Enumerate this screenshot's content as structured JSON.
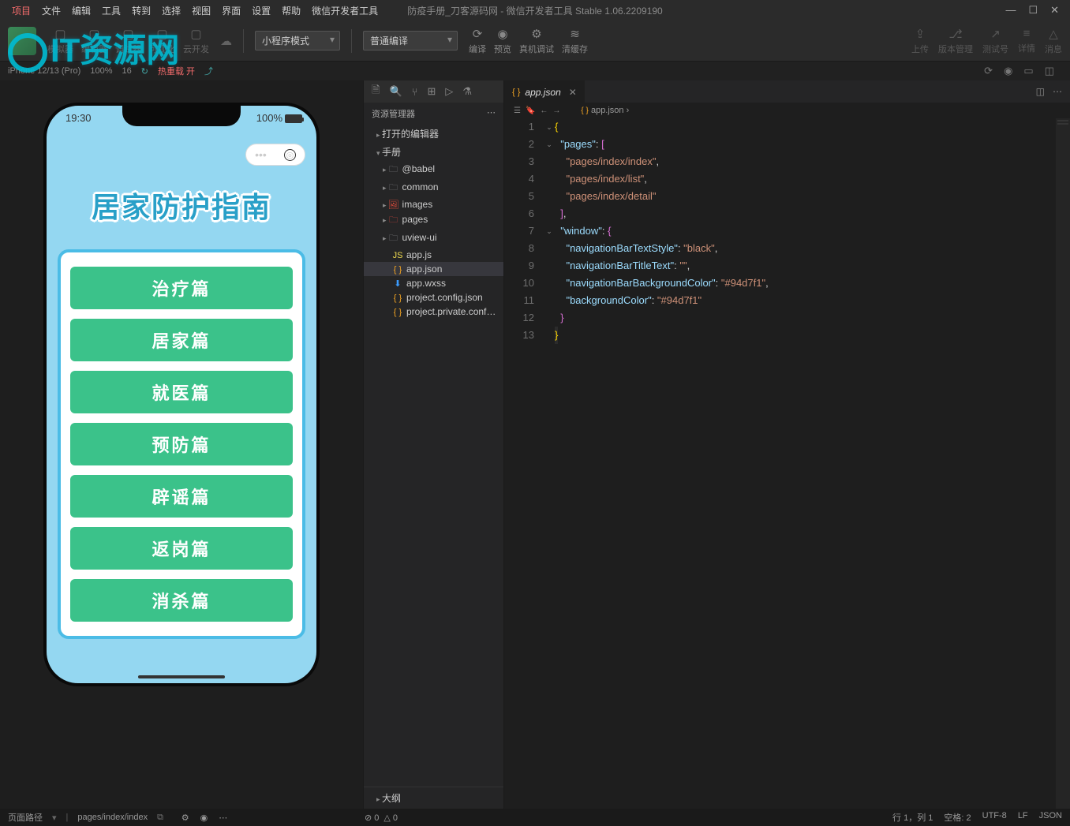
{
  "watermark": "IT资源网",
  "titlebar": {
    "menus": [
      "项目",
      "文件",
      "编辑",
      "工具",
      "转到",
      "选择",
      "视图",
      "界面",
      "设置",
      "帮助",
      "微信开发者工具"
    ],
    "title": "防疫手册_刀客源码网 - 微信开发者工具 Stable 1.06.2209190"
  },
  "toolbar": {
    "groups1": [
      "模拟器",
      "编辑器",
      "调试器",
      "可视化",
      "云开发"
    ],
    "select1": "小程序模式",
    "select2": "普通编译",
    "actions": [
      {
        "icon": "⟳",
        "label": "编译"
      },
      {
        "icon": "◉",
        "label": "预览"
      },
      {
        "icon": "⚙",
        "label": "真机调试"
      },
      {
        "icon": "≋",
        "label": "清缓存"
      }
    ],
    "right": [
      {
        "icon": "⇪",
        "label": "上传"
      },
      {
        "icon": "⎇",
        "label": "版本管理"
      },
      {
        "icon": "↗",
        "label": "测试号"
      },
      {
        "icon": "≡",
        "label": "详情"
      },
      {
        "icon": "△",
        "label": "消息"
      }
    ]
  },
  "devicebar": {
    "device": "iPhone 12/13 (Pro)",
    "zoom": "100%",
    "font": "16",
    "reload": "热重载 开",
    "iconglyphs": [
      "⟳",
      "◉",
      "▭",
      "◫"
    ]
  },
  "phone": {
    "time": "19:30",
    "battery": "100%",
    "title": "居家防护指南",
    "buttons": [
      "治疗篇",
      "居家篇",
      "就医篇",
      "预防篇",
      "辟谣篇",
      "返岗篇",
      "消杀篇"
    ]
  },
  "explorer": {
    "header": "资源管理器",
    "section1": "打开的编辑器",
    "section2": "手册",
    "tree": [
      {
        "icon": "folder",
        "label": "@babel",
        "chev": "▸"
      },
      {
        "icon": "folder",
        "label": "common",
        "chev": "▸"
      },
      {
        "icon": "img",
        "label": "images",
        "chev": "▸",
        "cls": "red"
      },
      {
        "icon": "folder",
        "label": "pages",
        "chev": "▸",
        "cls": "red"
      },
      {
        "icon": "folder",
        "label": "uview-ui",
        "chev": "▸"
      },
      {
        "icon": "js",
        "label": "app.js"
      },
      {
        "icon": "json",
        "label": "app.json",
        "selected": true
      },
      {
        "icon": "wxss",
        "label": "app.wxss"
      },
      {
        "icon": "json",
        "label": "project.config.json"
      },
      {
        "icon": "json",
        "label": "project.private.config.js..."
      }
    ],
    "outline": "大纲"
  },
  "editor": {
    "tab": "app.json",
    "crumb": "app.json",
    "lines": 13,
    "json": {
      "pages": [
        "pages/index/index",
        "pages/index/list",
        "pages/index/detail"
      ],
      "window": {
        "navigationBarTextStyle": "black",
        "navigationBarTitleText": "",
        "navigationBarBackgroundColor": "#94d7f1",
        "backgroundColor": "#94d7f1"
      }
    }
  },
  "statusbar": {
    "path_label": "页面路径",
    "path": "pages/index/index",
    "errors": "⊘ 0",
    "warnings": "△ 0",
    "right": [
      "行 1，列 1",
      "空格: 2",
      "UTF-8",
      "LF",
      "JSON"
    ]
  }
}
